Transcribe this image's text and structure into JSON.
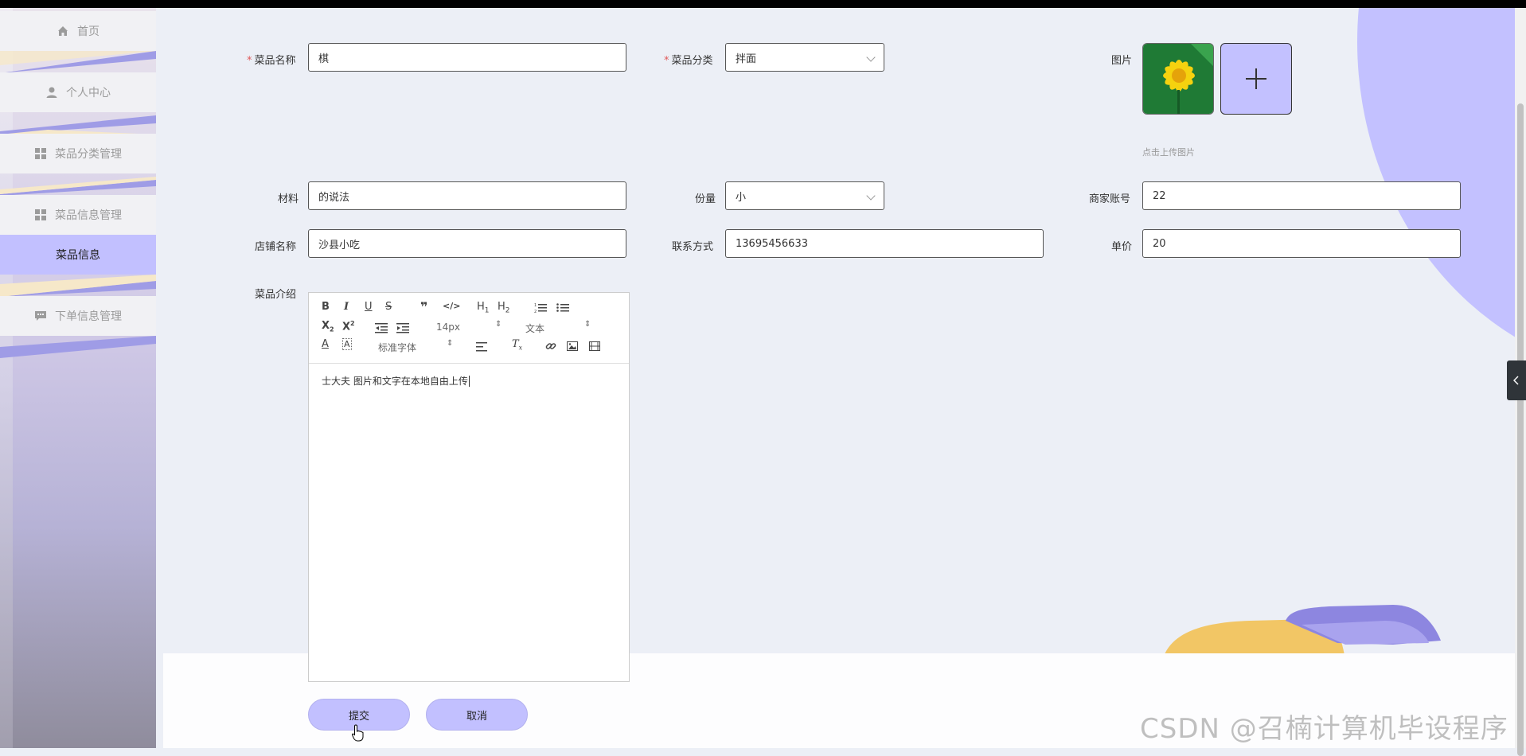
{
  "sidebar": {
    "items": [
      {
        "label": "首页",
        "icon": "home-icon"
      },
      {
        "label": "个人中心",
        "icon": "user-icon"
      },
      {
        "label": "菜品分类管理",
        "icon": "grid-icon"
      },
      {
        "label": "菜品信息管理",
        "icon": "grid-icon"
      },
      {
        "label": "菜品信息",
        "active": true
      },
      {
        "label": "下单信息管理",
        "icon": "chat-icon"
      }
    ]
  },
  "form": {
    "name_label": "菜品名称",
    "name_value": "棋",
    "category_label": "菜品分类",
    "category_value": "拌面",
    "image_label": "图片",
    "upload_tip": "点击上传图片",
    "material_label": "材料",
    "material_value": "的说法",
    "portion_label": "份量",
    "portion_value": "小",
    "merchant_label": "商家账号",
    "merchant_value": "22",
    "shop_label": "店铺名称",
    "shop_value": "沙县小吃",
    "contact_label": "联系方式",
    "contact_value": "13695456633",
    "price_label": "单价",
    "price_value": "20",
    "intro_label": "菜品介绍"
  },
  "editor": {
    "font_size": "14px",
    "heading_select": "文本",
    "font_family": "标准字体",
    "content": "士大夫  图片和文字在本地自由上传"
  },
  "buttons": {
    "submit": "提交",
    "cancel": "取消"
  },
  "watermark": "CSDN @召楠计算机毕设程序",
  "colors": {
    "accent": "#c2c0ff",
    "background": "#eceff6",
    "required": "#e05a5a"
  }
}
